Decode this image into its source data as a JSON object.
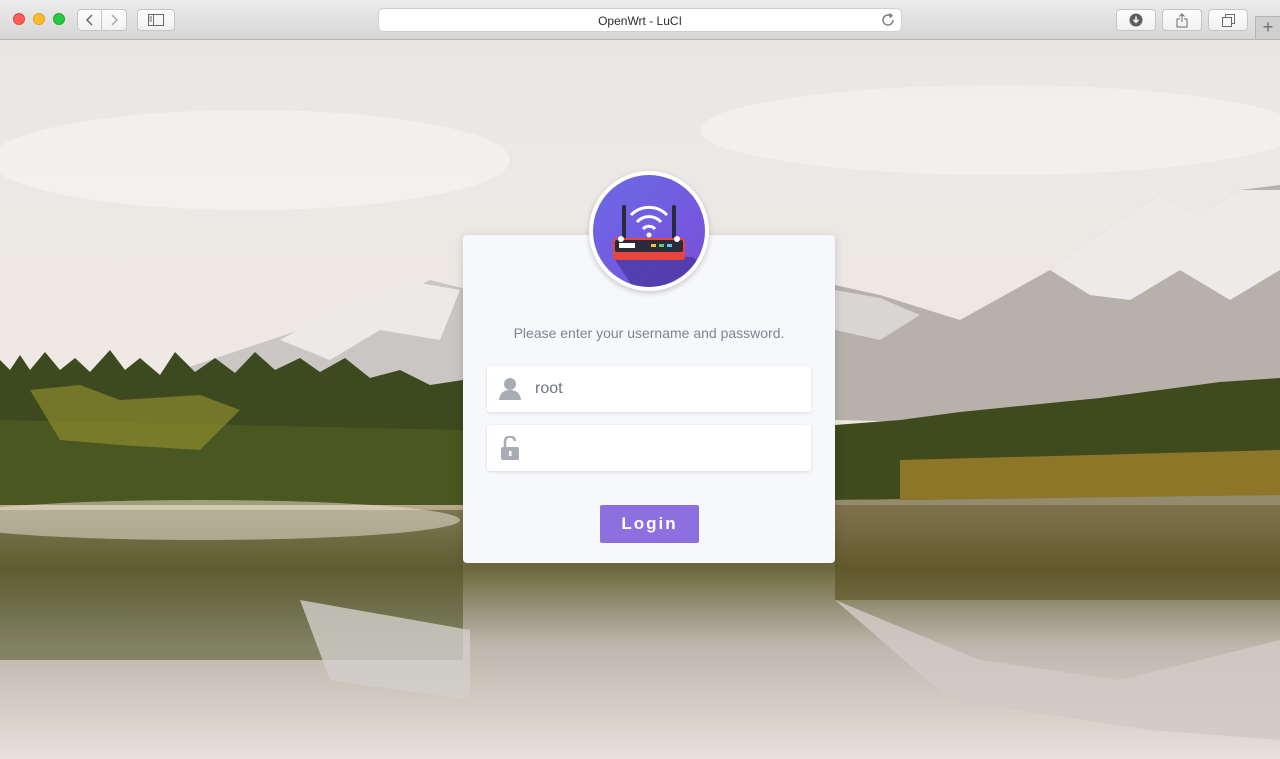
{
  "browser": {
    "page_title": "OpenWrt - LuCI",
    "icons": [
      "back-icon",
      "forward-icon",
      "sidebar-icon",
      "reload-icon",
      "download-icon",
      "share-icon",
      "tabs-icon",
      "plus-icon"
    ]
  },
  "login": {
    "prompt": "Please enter your username and password.",
    "username_value": "root",
    "password_value": "",
    "button_label": "Login",
    "accent_color": "#8e6fe0",
    "logo_icon": "router-wifi-icon",
    "username_icon": "user-icon",
    "password_icon": "unlocked-padlock-icon"
  }
}
